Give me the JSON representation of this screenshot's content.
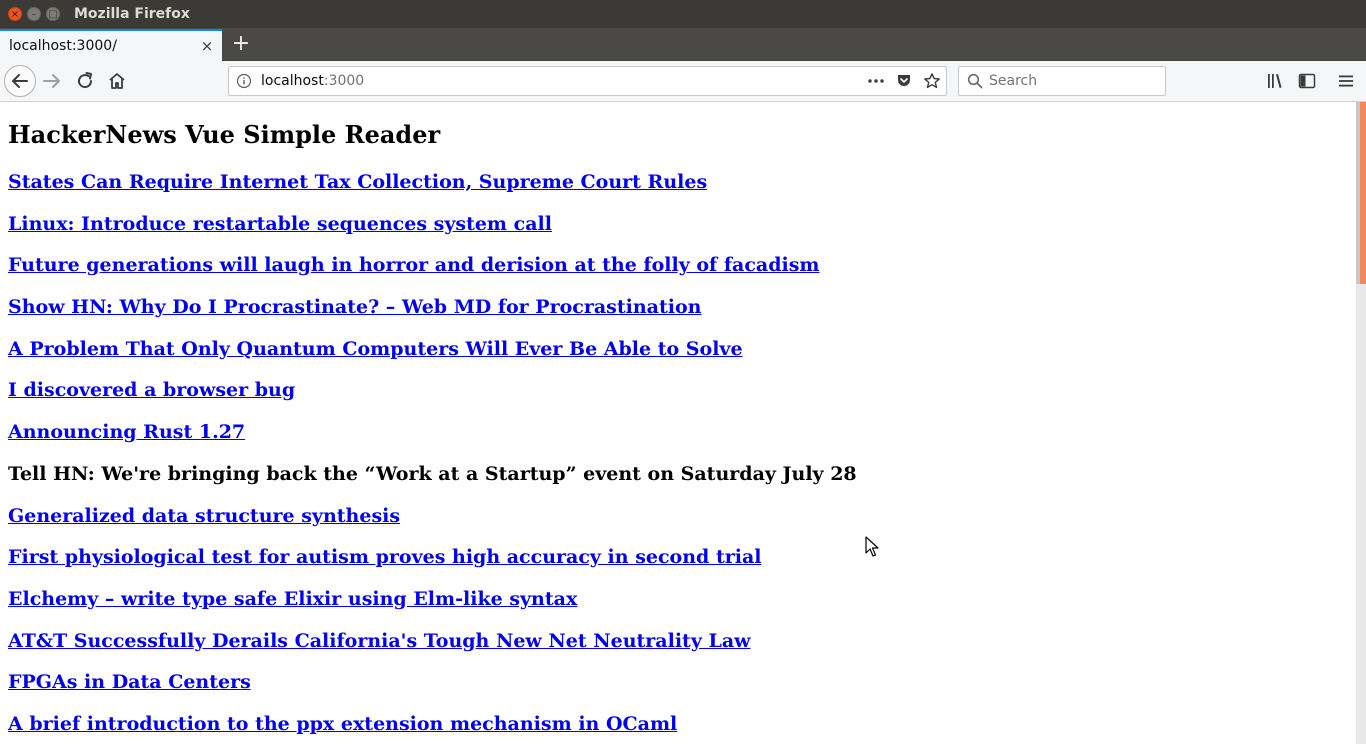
{
  "window": {
    "title": "Mozilla Firefox",
    "close_glyph": "×",
    "min_glyph": "–",
    "max_glyph": "□"
  },
  "tabs": [
    {
      "title": "localhost:3000/",
      "active": true,
      "close_glyph": "×"
    }
  ],
  "new_tab_glyph": "+",
  "navbar": {
    "url_host": "localhost",
    "url_port": ":3000",
    "search_placeholder": "Search"
  },
  "icons": {
    "back": "back-arrow-icon",
    "forward": "forward-arrow-icon",
    "reload": "reload-icon",
    "home": "home-icon",
    "info": "info-icon",
    "page_actions": "more-dots-icon",
    "pocket": "pocket-icon",
    "bookmark": "star-icon",
    "search": "search-icon",
    "library": "library-icon",
    "sidebar": "sidebar-icon",
    "menu": "hamburger-menu-icon"
  },
  "colors": {
    "link": "#0000ee",
    "tab_accent": "#0a84ff",
    "scroll_accent": "#f08a5d",
    "titlebar": "#3b3a37"
  },
  "page": {
    "heading": "HackerNews Vue Simple Reader",
    "stories": [
      {
        "title": "States Can Require Internet Tax Collection, Supreme Court Rules",
        "link": true
      },
      {
        "title": "Linux: Introduce restartable sequences system call",
        "link": true
      },
      {
        "title": "Future generations will laugh in horror and derision at the folly of facadism",
        "link": true
      },
      {
        "title": "Show HN: Why Do I Procrastinate? – Web MD for Procrastination",
        "link": true
      },
      {
        "title": "A Problem That Only Quantum Computers Will Ever Be Able to Solve",
        "link": true
      },
      {
        "title": "I discovered a browser bug",
        "link": true
      },
      {
        "title": "Announcing Rust 1.27",
        "link": true
      },
      {
        "title": "Tell HN: We're bringing back the “Work at a Startup” event on Saturday July 28",
        "link": false
      },
      {
        "title": "Generalized data structure synthesis",
        "link": true
      },
      {
        "title": "First physiological test for autism proves high accuracy in second trial",
        "link": true
      },
      {
        "title": "Elchemy – write type safe Elixir using Elm-like syntax",
        "link": true
      },
      {
        "title": "AT&T Successfully Derails California's Tough New Net Neutrality Law",
        "link": true
      },
      {
        "title": "FPGAs in Data Centers",
        "link": true
      },
      {
        "title": "A brief introduction to the ppx extension mechanism in OCaml",
        "link": true
      }
    ]
  }
}
